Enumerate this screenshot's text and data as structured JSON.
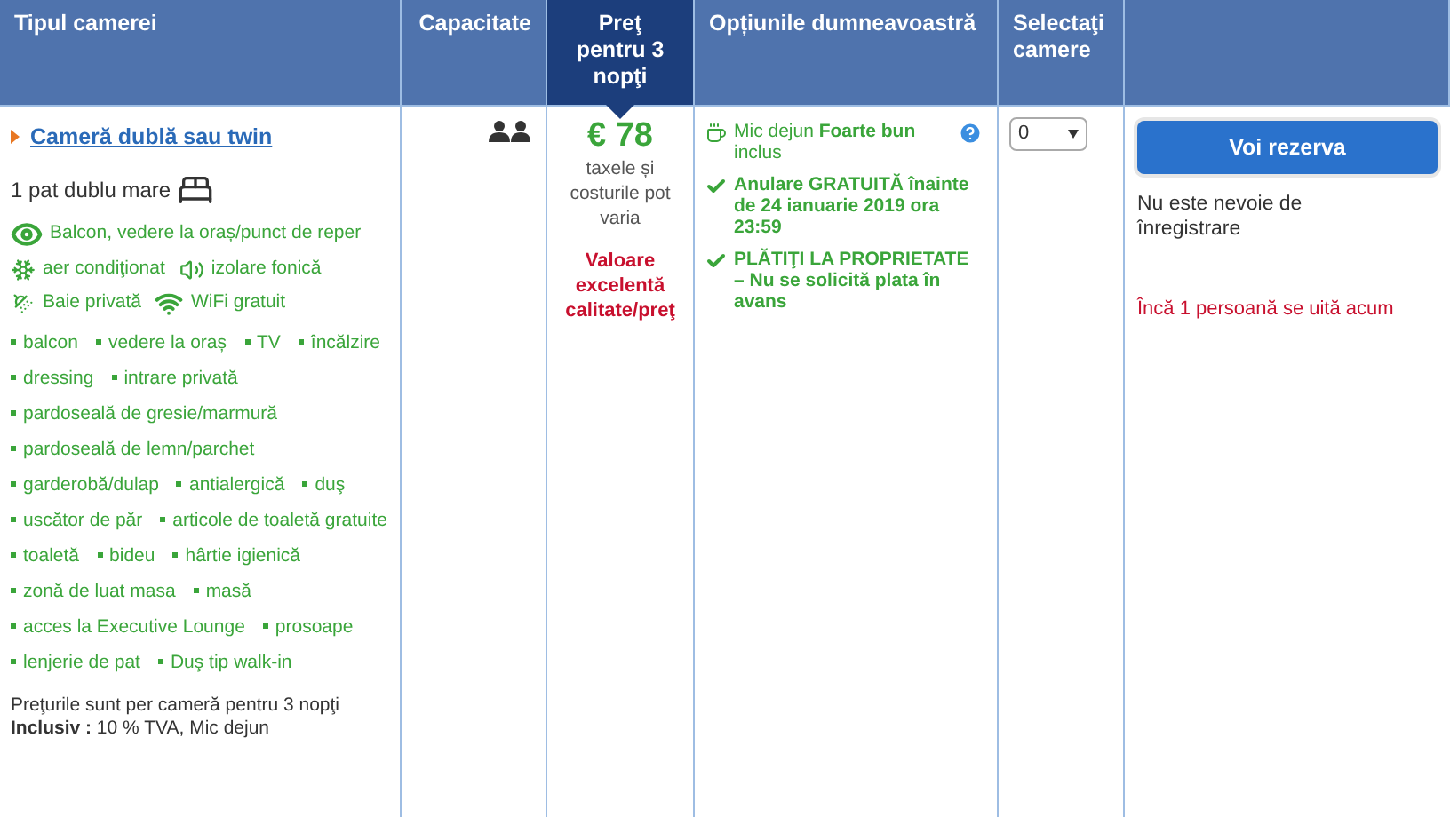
{
  "columns": [
    {
      "label": "Tipul camerei",
      "highlighted": false
    },
    {
      "label": "Capacitate",
      "highlighted": false
    },
    {
      "label": "Preţ pentru 3 nopţi",
      "highlighted": true
    },
    {
      "label": "Opțiunile dumneavoastră",
      "highlighted": false
    },
    {
      "label": "Selectaţi camere",
      "highlighted": false
    },
    {
      "highlighted": false
    }
  ],
  "room": {
    "name": "Cameră dublă sau twin",
    "bed": "1 pat dublu mare",
    "highlights": [
      {
        "kind": "eye",
        "label": "Balcon, vedere la oraș/punct de reper"
      },
      {
        "kind": "snowflake",
        "label": "aer condiţionat"
      },
      {
        "kind": "speaker",
        "label": "izolare fonică"
      },
      {
        "kind": "shower",
        "label": "Baie privată"
      },
      {
        "kind": "wifi",
        "label": "WiFi gratuit"
      }
    ],
    "facilities": [
      "balcon",
      "vedere la oraș",
      "TV",
      "încălzire",
      "dressing",
      "intrare privată",
      "pardoseală de gresie/marmură",
      "pardoseală de lemn/parchet",
      "garderobă/dulap",
      "antialergică",
      "duş",
      "uscător de păr",
      "articole de toaletă gratuite",
      "toaletă",
      "bideu",
      "hârtie igienică",
      "zonă de luat masa",
      "masă",
      "acces la Executive Lounge",
      "prosoape",
      "lenjerie de pat",
      "Duş tip walk-in"
    ],
    "price_note": "Preţurile sunt per cameră pentru 3 nopţi",
    "included": "**Inclusiv :** 10 % TVA, Mic dejun"
  },
  "price": {
    "amount": "€ 78",
    "note": "taxele și costurile pot varia",
    "badge": "Valoare excelentă calitate/preţ"
  },
  "options": [
    {
      "kind": "coffee",
      "text": "Mic dejun **Foarte bun** inclus"
    },
    {
      "kind": "check",
      "text": "Anulare GRATUITĂ înainte de 24 ianuarie 2019 ora 23:59"
    },
    {
      "kind": "check",
      "text": "PLĂTIŢI LA PROPRIETATE – Nu se solicită plata în avans"
    }
  ],
  "select": {
    "value": "0"
  },
  "reserve": {
    "button": "Voi rezerva",
    "note": "Nu este nevoie de înregistrare",
    "alert": "Încă 1 persoană se uită acum"
  }
}
